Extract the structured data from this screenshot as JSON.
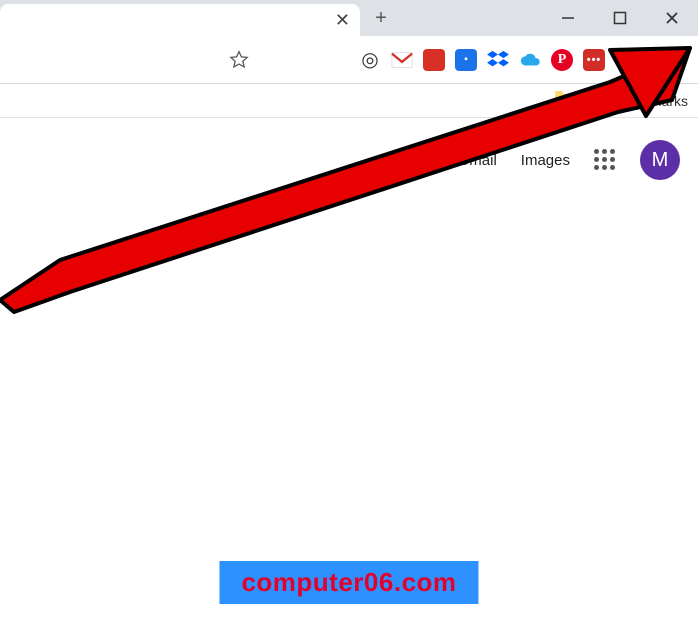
{
  "window_controls": {
    "minimize": "minimize",
    "maximize": "maximize",
    "close": "close"
  },
  "tabs": {
    "new_tab_tooltip": "+"
  },
  "toolbar": {
    "star_icon": "bookmark-star",
    "extensions": [
      {
        "name": "portal-icon",
        "glyph": "◎",
        "bg": "",
        "fg": "#333"
      },
      {
        "name": "gmail-icon",
        "glyph": "M",
        "bg": "#fff",
        "fg": "#d93025",
        "border": true
      },
      {
        "name": "red-box-icon",
        "glyph": "",
        "bg": "#d93025",
        "fg": "#fff"
      },
      {
        "name": "doc-icon",
        "glyph": "■",
        "bg": "#1a73e8",
        "fg": "#fff"
      },
      {
        "name": "dropbox-icon",
        "glyph": "",
        "bg": "",
        "fg": "#0061ff",
        "svg": "dropbox"
      },
      {
        "name": "onedrive-icon",
        "glyph": "",
        "bg": "",
        "fg": "#28a8ea",
        "svg": "cloud"
      },
      {
        "name": "pinterest-icon",
        "glyph": "P",
        "bg": "#e60023",
        "fg": "#fff",
        "round": true
      },
      {
        "name": "lastpass-icon",
        "glyph": "•••",
        "bg": "#d32d27",
        "fg": "#fff"
      }
    ]
  },
  "bookmarks": {
    "other_label": "Other bookmarks"
  },
  "ntp": {
    "gmail": "Gmail",
    "images": "Images",
    "avatar_letter": "M"
  },
  "watermark": "computer06.com"
}
